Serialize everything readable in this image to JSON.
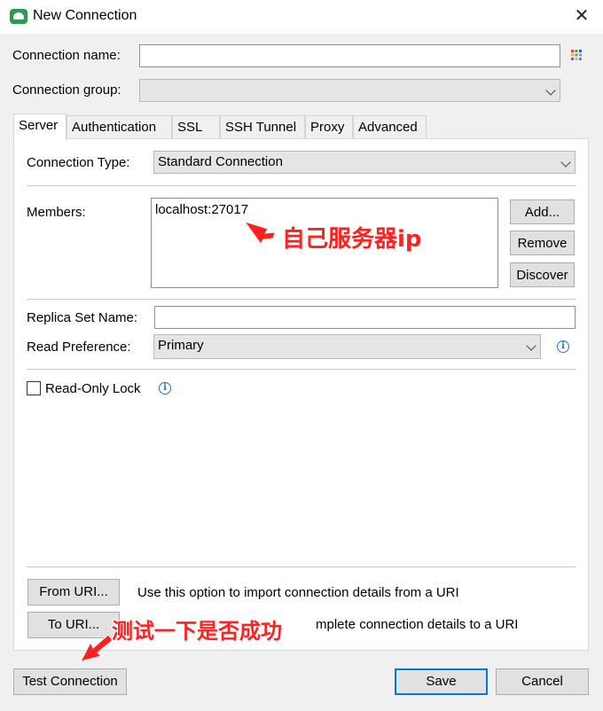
{
  "window": {
    "title": "New Connection",
    "close_symbol": "✕",
    "icon": "robo3t-app-icon"
  },
  "form": {
    "connection_name_label": "Connection name:",
    "connection_name_value": "",
    "connection_group_label": "Connection group:",
    "connection_group_value": ""
  },
  "tabs": [
    "Server",
    "Authentication",
    "SSL",
    "SSH Tunnel",
    "Proxy",
    "Advanced"
  ],
  "active_tab": "Server",
  "server": {
    "connection_type_label": "Connection Type:",
    "connection_type_value": "Standard Connection",
    "members_label": "Members:",
    "members_value": "localhost:27017",
    "add_button": "Add...",
    "remove_button": "Remove",
    "discover_button": "Discover",
    "replica_set_label": "Replica Set Name:",
    "replica_set_value": "",
    "read_pref_label": "Read Preference:",
    "read_pref_value": "Primary",
    "read_only_label": "Read-Only Lock",
    "read_only_checked": false,
    "info_symbol": "i"
  },
  "uri": {
    "from_button": "From URI...",
    "from_desc": "Use this option to import connection details from a URI",
    "to_button": "To URI...",
    "to_desc_visible": "mplete connection details to a URI"
  },
  "footer": {
    "test_button": "Test Connection",
    "save_button": "Save",
    "cancel_button": "Cancel"
  },
  "annotations": {
    "server_ip": "自己服务器ip",
    "test_success": "测试一下是否成功",
    "color": "#ff2020"
  },
  "colors": {
    "focus_blue": "#0078d7",
    "info_blue": "#2b6fd6",
    "panel_bg": "#ffffff",
    "window_bg": "#f0f0f0"
  }
}
